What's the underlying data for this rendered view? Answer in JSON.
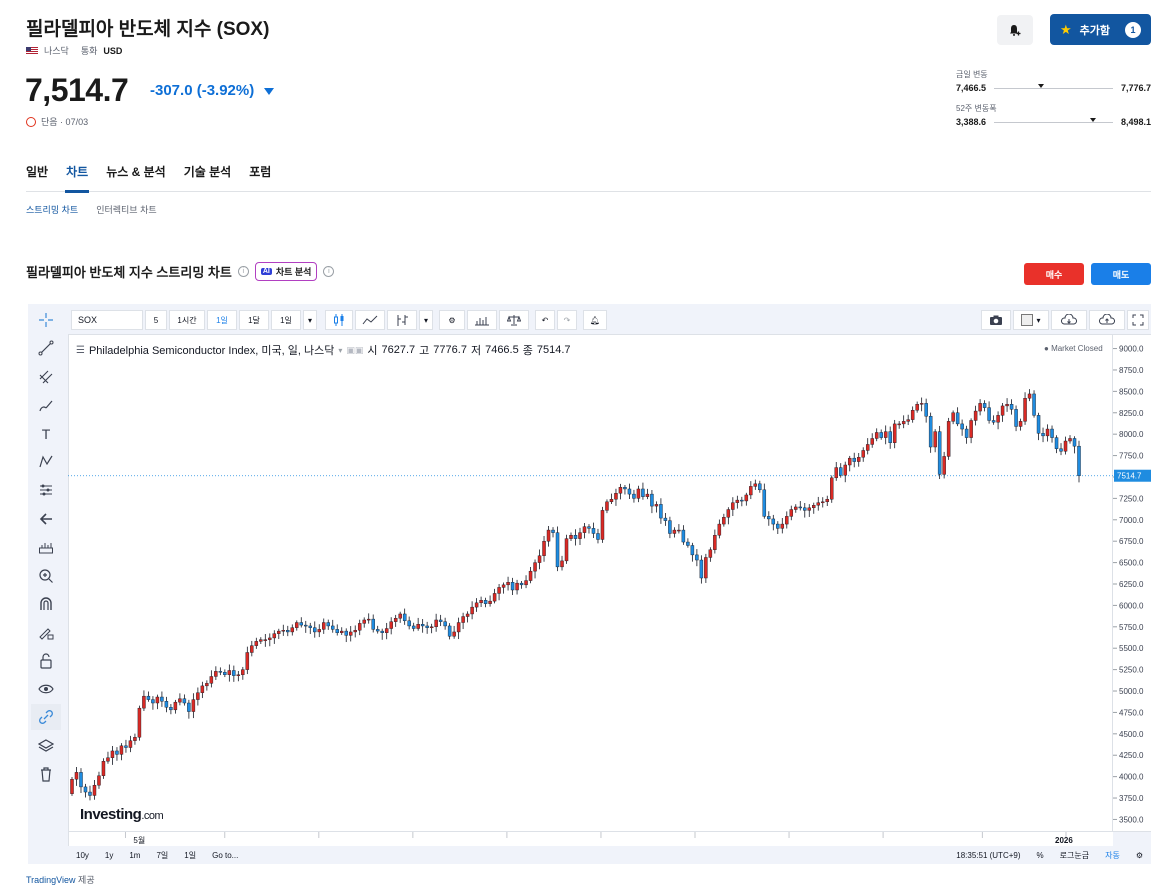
{
  "header": {
    "title": "필라델피아 반도체 지수 (SOX)",
    "exchange": "나스닥",
    "currency_label": "통화",
    "currency": "USD",
    "price": "7,514.7",
    "change": "-307.0",
    "change_pct": "(-3.92%)",
    "status": "단음 · 07/03",
    "add_label": "추가함",
    "add_count": "1"
  },
  "ranges": {
    "day_label": "금일 변동",
    "day_low": "7,466.5",
    "day_high": "7,776.7",
    "day_position": 0.37,
    "week52_label": "52주 변동폭",
    "week52_low": "3,388.6",
    "week52_high": "8,498.1",
    "week52_position": 0.81
  },
  "tabs": [
    "일반",
    "차트",
    "뉴스 & 분석",
    "기술 분석",
    "포럼"
  ],
  "subtabs": [
    "스트리밍 차트",
    "인터렉티브 차트"
  ],
  "section": {
    "title": "필라델피아 반도체 지수 스트리밍 차트",
    "ai_label": "차트 분석",
    "buy_label": "매수",
    "sell_label": "매도"
  },
  "toolbar": {
    "symbol": "SOX",
    "intervals": [
      "5",
      "1시간",
      "1일",
      "1달",
      "1일"
    ]
  },
  "chart_legend": {
    "name": "Philadelphia Semiconductor Index, 미국, 일, 나스닥",
    "o_label": "시",
    "o": "7627.7",
    "h_label": "고",
    "h": "7776.7",
    "l_label": "저",
    "l": "7466.5",
    "c_label": "종",
    "c": "7514.7",
    "market_status": "Market Closed",
    "current_price_tag": "7514.7"
  },
  "bottombar": {
    "ranges": [
      "10y",
      "1y",
      "1m",
      "7일",
      "1일",
      "Go to..."
    ],
    "time": "18:35:51 (UTC+9)",
    "pct": "%",
    "log": "로그눈금",
    "auto": "자동"
  },
  "branding": {
    "logo": "Investing",
    "logo_suffix": ".com",
    "credit": "TradingView",
    "credit_suffix": "제공"
  },
  "colors": {
    "up": "#d92a25",
    "down": "#1f8ce0",
    "accent": "#1256a0"
  },
  "chart_data": {
    "type": "candlestick",
    "ylim": [
      3400,
      9100
    ],
    "y_ticks": [
      3500,
      3750,
      4000,
      4250,
      4500,
      4750,
      5000,
      5250,
      5500,
      5750,
      6000,
      6250,
      6500,
      6750,
      7000,
      7250,
      7500,
      7750,
      8000,
      8250,
      8500,
      8750,
      9000
    ],
    "y_tick_labels": [
      "3500.0",
      "3750.0",
      "4000.0",
      "4250.0",
      "4500.0",
      "4750.0",
      "5000.0",
      "5250.0",
      "5500.0",
      "5750.0",
      "6000.0",
      "6250.0",
      "6500.0",
      "6750.0",
      "7000.0",
      "7250.0",
      "7500.0",
      "7750.0",
      "8000.0",
      "8250.0",
      "8500.0",
      "8750.0",
      "9000.0"
    ],
    "x_labels": [
      {
        "label": "5월",
        "index": 15
      },
      {
        "label": "2026",
        "index": 220
      }
    ],
    "current_price": 7514.7,
    "close": [
      3970,
      4050,
      3880,
      3820,
      3780,
      3900,
      4010,
      4180,
      4220,
      4300,
      4260,
      4360,
      4340,
      4420,
      4460,
      4800,
      4940,
      4900,
      4860,
      4930,
      4880,
      4810,
      4780,
      4870,
      4910,
      4860,
      4760,
      4900,
      4980,
      5060,
      5090,
      5170,
      5230,
      5220,
      5190,
      5240,
      5180,
      5190,
      5250,
      5450,
      5530,
      5580,
      5600,
      5600,
      5620,
      5670,
      5700,
      5710,
      5690,
      5740,
      5800,
      5770,
      5760,
      5740,
      5690,
      5720,
      5800,
      5760,
      5720,
      5680,
      5700,
      5650,
      5690,
      5710,
      5790,
      5830,
      5840,
      5720,
      5700,
      5680,
      5730,
      5810,
      5850,
      5900,
      5820,
      5760,
      5730,
      5780,
      5760,
      5740,
      5750,
      5830,
      5810,
      5760,
      5640,
      5690,
      5800,
      5870,
      5900,
      5980,
      6030,
      6060,
      6020,
      6050,
      6140,
      6210,
      6240,
      6270,
      6180,
      6260,
      6240,
      6290,
      6400,
      6500,
      6580,
      6750,
      6880,
      6850,
      6450,
      6520,
      6780,
      6820,
      6780,
      6850,
      6920,
      6900,
      6840,
      6770,
      7110,
      7210,
      7240,
      7310,
      7380,
      7360,
      7300,
      7250,
      7360,
      7270,
      7300,
      7160,
      7180,
      7020,
      6990,
      6840,
      6880,
      6880,
      6740,
      6700,
      6590,
      6530,
      6320,
      6560,
      6650,
      6820,
      6950,
      7030,
      7120,
      7200,
      7230,
      7220,
      7290,
      7390,
      7420,
      7350,
      7040,
      7010,
      6950,
      6900,
      6950,
      7040,
      7120,
      7150,
      7140,
      7110,
      7140,
      7170,
      7200,
      7210,
      7240,
      7490,
      7610,
      7520,
      7640,
      7720,
      7680,
      7730,
      7810,
      7880,
      7950,
      8020,
      7960,
      8030,
      7900,
      8120,
      8120,
      8150,
      8170,
      8280,
      8350,
      8360,
      8210,
      7850,
      8030,
      7530,
      7740,
      8150,
      8250,
      8120,
      8060,
      7960,
      8160,
      8270,
      8360,
      8310,
      8160,
      8140,
      8220,
      8330,
      8350,
      8290,
      8090,
      8150,
      8420,
      8470,
      8220,
      8010,
      7980,
      8060,
      7960,
      7830,
      7800,
      7920,
      7950,
      7860,
      7514.7
    ],
    "open": [
      3800,
      3970,
      4050,
      3880,
      3820,
      3780,
      3900,
      4010,
      4180,
      4220,
      4300,
      4260,
      4360,
      4340,
      4420,
      4460,
      4800,
      4940,
      4900,
      4860,
      4930,
      4880,
      4810,
      4780,
      4870,
      4910,
      4860,
      4760,
      4900,
      4980,
      5060,
      5090,
      5170,
      5230,
      5220,
      5190,
      5240,
      5180,
      5190,
      5250,
      5450,
      5530,
      5580,
      5600,
      5600,
      5620,
      5670,
      5700,
      5710,
      5690,
      5740,
      5800,
      5770,
      5760,
      5740,
      5690,
      5720,
      5800,
      5760,
      5720,
      5680,
      5700,
      5650,
      5690,
      5710,
      5790,
      5830,
      5840,
      5720,
      5700,
      5680,
      5730,
      5810,
      5850,
      5900,
      5820,
      5760,
      5730,
      5780,
      5760,
      5740,
      5750,
      5830,
      5810,
      5760,
      5640,
      5690,
      5800,
      5870,
      5900,
      5980,
      6030,
      6060,
      6020,
      6050,
      6140,
      6210,
      6240,
      6270,
      6180,
      6260,
      6240,
      6290,
      6400,
      6500,
      6580,
      6750,
      6880,
      6850,
      6450,
      6520,
      6780,
      6820,
      6780,
      6850,
      6920,
      6900,
      6840,
      6770,
      7110,
      7210,
      7240,
      7310,
      7380,
      7360,
      7300,
      7250,
      7360,
      7270,
      7300,
      7160,
      7180,
      7020,
      6990,
      6840,
      6880,
      6880,
      6740,
      6700,
      6590,
      6530,
      6320,
      6560,
      6650,
      6820,
      6950,
      7030,
      7120,
      7200,
      7230,
      7220,
      7290,
      7390,
      7420,
      7350,
      7040,
      7010,
      6950,
      6900,
      6950,
      7040,
      7120,
      7150,
      7140,
      7110,
      7140,
      7170,
      7200,
      7210,
      7240,
      7490,
      7610,
      7520,
      7640,
      7720,
      7680,
      7730,
      7810,
      7880,
      7950,
      8020,
      7960,
      8030,
      7900,
      8120,
      8120,
      8150,
      8170,
      8280,
      8350,
      8360,
      8210,
      7850,
      8030,
      7530,
      7740,
      8150,
      8250,
      8120,
      8060,
      7960,
      8160,
      8270,
      8360,
      8310,
      8160,
      8140,
      8220,
      8330,
      8350,
      8290,
      8090,
      8150,
      8420,
      8470,
      8220,
      8010,
      7980,
      8060,
      7960,
      7830,
      7800,
      7920,
      7950,
      7860,
      7627.7
    ]
  }
}
